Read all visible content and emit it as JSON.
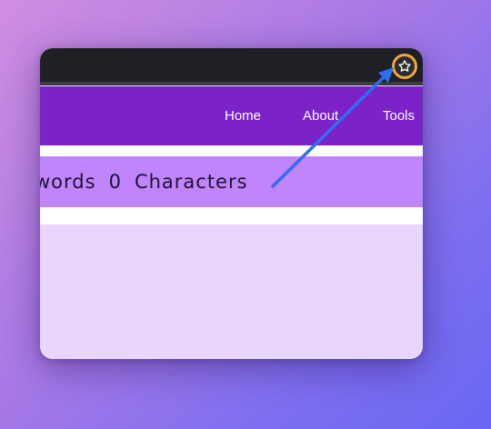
{
  "nav": {
    "links": [
      {
        "label": "Home"
      },
      {
        "label": "About"
      },
      {
        "label": "Tools"
      }
    ]
  },
  "stats": {
    "word_label": "words",
    "char_count": "0",
    "char_label": "Characters"
  },
  "titlebar": {
    "action_icon": "star-icon"
  },
  "colors": {
    "navbar": "#7b22c9",
    "stats_bar": "#c084fb",
    "content": "#e8d6fd",
    "titlebar": "#1f2023",
    "highlight_ring": "#f0a53c",
    "arrow": "#2f6df0"
  }
}
